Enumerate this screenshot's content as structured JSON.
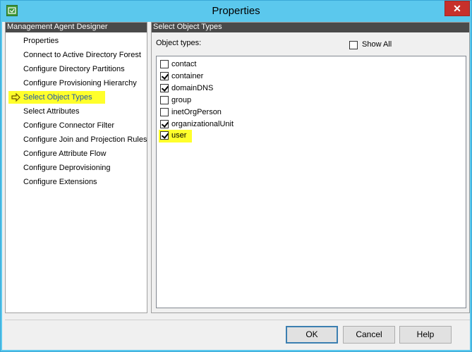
{
  "window": {
    "title": "Properties",
    "close_symbol": "✕",
    "app_icon": "app-icon"
  },
  "left_pane": {
    "header": "Management Agent Designer",
    "current_icon": "arrow-right-icon",
    "items": [
      {
        "label": "Properties"
      },
      {
        "label": "Connect to Active Directory Forest"
      },
      {
        "label": "Configure Directory Partitions"
      },
      {
        "label": "Configure Provisioning Hierarchy"
      },
      {
        "label": "Select Object Types"
      },
      {
        "label": "Select Attributes"
      },
      {
        "label": "Configure Connector Filter"
      },
      {
        "label": "Configure Join and Projection Rules"
      },
      {
        "label": "Configure Attribute Flow"
      },
      {
        "label": "Configure Deprovisioning"
      },
      {
        "label": "Configure Extensions"
      }
    ],
    "selected_index": 4
  },
  "right_pane": {
    "header": "Select Object Types",
    "object_types_label": "Object types:",
    "show_all": {
      "label": "Show All",
      "checked": false
    },
    "object_types": [
      {
        "label": "contact",
        "checked": false
      },
      {
        "label": "container",
        "checked": true
      },
      {
        "label": "domainDNS",
        "checked": true
      },
      {
        "label": "group",
        "checked": false
      },
      {
        "label": "inetOrgPerson",
        "checked": false
      },
      {
        "label": "organizationalUnit",
        "checked": true
      },
      {
        "label": "user",
        "checked": true
      }
    ]
  },
  "buttons": {
    "ok": "OK",
    "cancel": "Cancel",
    "help": "Help"
  },
  "colors": {
    "titlebar": "#5bc8ed",
    "highlight": "#ffff2b",
    "header_bg": "#4a4a4a",
    "close": "#c7302b"
  }
}
